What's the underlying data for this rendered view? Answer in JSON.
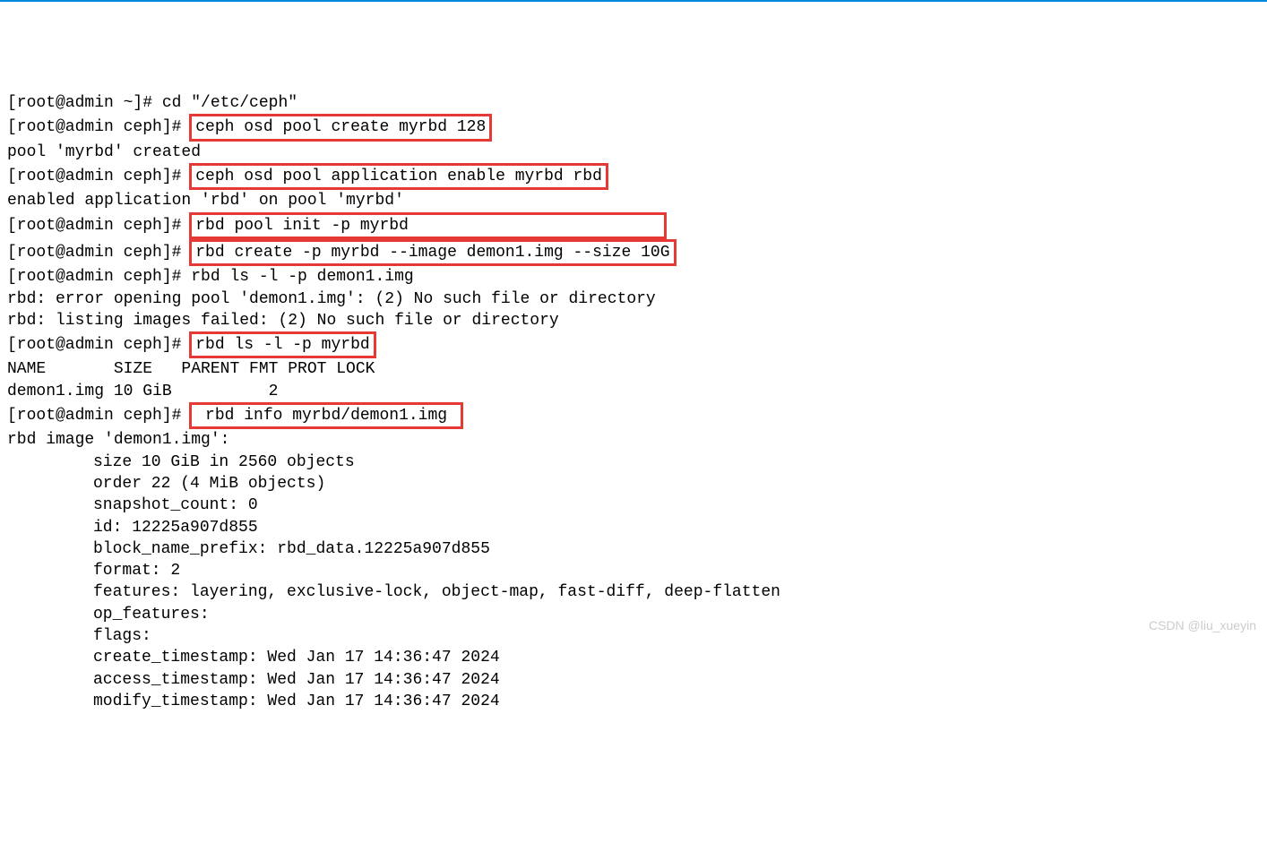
{
  "lines": [
    {
      "prompt": "[root@admin ~]# ",
      "cmd": "cd \"/etc/ceph\"",
      "hl": false
    },
    {
      "prompt": "[root@admin ceph]# ",
      "cmd": "ceph osd pool create myrbd 128",
      "hl": true
    },
    {
      "output": "pool 'myrbd' created"
    },
    {
      "prompt": "[root@admin ceph]# ",
      "cmd": "ceph osd pool application enable myrbd rbd",
      "hl": true
    },
    {
      "output": "enabled application 'rbd' on pool 'myrbd'"
    },
    {
      "prompt": "[root@admin ceph]# ",
      "cmd": "rbd pool init -p myrbd                          ",
      "hl": true,
      "group": "start"
    },
    {
      "prompt": "[root@admin ceph]# ",
      "cmd": "rbd create -p myrbd --image demon1.img --size 10G",
      "hl": true,
      "group": "end"
    },
    {
      "prompt": "[root@admin ceph]# ",
      "cmd": "rbd ls -l -p demon1.img",
      "hl": false
    },
    {
      "output": "rbd: error opening pool 'demon1.img': (2) No such file or directory"
    },
    {
      "output": "rbd: listing images failed: (2) No such file or directory"
    },
    {
      "prompt": "[root@admin ceph]# ",
      "cmd": "rbd ls -l -p myrbd",
      "hl": true
    },
    {
      "output": "NAME       SIZE   PARENT FMT PROT LOCK"
    },
    {
      "output": "demon1.img 10 GiB          2"
    },
    {
      "prompt": "[root@admin ceph]# ",
      "cmd": " rbd info myrbd/demon1.img ",
      "hl": true
    },
    {
      "output": "rbd image 'demon1.img':"
    },
    {
      "output_indent": "size 10 GiB in 2560 objects"
    },
    {
      "output_indent": "order 22 (4 MiB objects)"
    },
    {
      "output_indent": "snapshot_count: 0"
    },
    {
      "output_indent": "id: 12225a907d855"
    },
    {
      "output_indent": "block_name_prefix: rbd_data.12225a907d855"
    },
    {
      "output_indent": "format: 2"
    },
    {
      "output_indent": "features: layering, exclusive-lock, object-map, fast-diff, deep-flatten"
    },
    {
      "output_indent": "op_features:"
    },
    {
      "output_indent": "flags:"
    },
    {
      "output_indent": "create_timestamp: Wed Jan 17 14:36:47 2024"
    },
    {
      "output_indent": "access_timestamp: Wed Jan 17 14:36:47 2024"
    },
    {
      "output_indent": "modify_timestamp: Wed Jan 17 14:36:47 2024"
    }
  ],
  "watermark": "CSDN @liu_xueyin"
}
